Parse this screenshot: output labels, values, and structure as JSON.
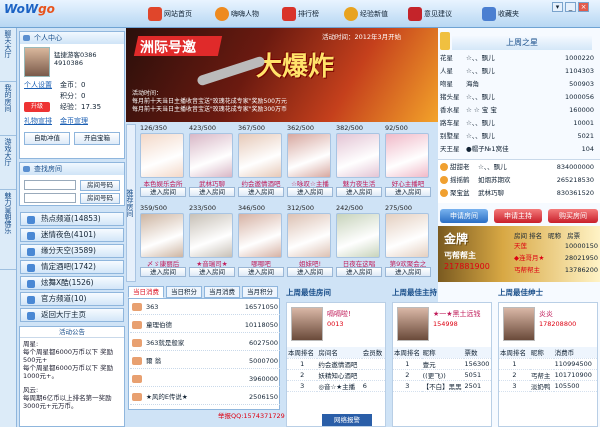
{
  "app": {
    "logo_text": "WoW",
    "logo_accent": "go",
    "window_controls": [
      "▾",
      "_",
      "×"
    ]
  },
  "nav": [
    {
      "label": "网站首页",
      "color": "#e0462b"
    },
    {
      "label": "嗨嗨人物",
      "color": "#ee8a1f"
    },
    {
      "label": "排行榜",
      "color": "#d9332a"
    },
    {
      "label": "经验新值",
      "color": "#e8a320"
    },
    {
      "label": "意见建议",
      "color": "#c4242a"
    },
    {
      "label": "收藏夹",
      "color": "#4b7fd1"
    }
  ],
  "left_strip": [
    "聊天大厅",
    "我的房间",
    "游戏大厅",
    "魅力皇朝佛乐"
  ],
  "profile": {
    "header": "个人中心",
    "nickname": "猛捷游客0386",
    "id": "4910386",
    "setting": "个人设置",
    "stats": [
      {
        "k": "金币",
        "v": "0"
      },
      {
        "k": "积分",
        "v": "0"
      },
      {
        "k": "经验",
        "v": "17.35"
      }
    ],
    "upgrade": "升级",
    "gift": "礼物宣排",
    "recharge": "金币宣理",
    "auto_charge": "自助冲值",
    "open_box": "开启宝箱"
  },
  "search": {
    "header": "查找房间",
    "room_btn": "房间号码",
    "room_btn2": "房间号码"
  },
  "menu": [
    {
      "label": "热点频道",
      "count": "(14853)"
    },
    {
      "label": "迷情夜色",
      "count": "(4101)"
    },
    {
      "label": "缘分天空",
      "count": "(3589)"
    },
    {
      "label": "情定酒吧",
      "count": "(1742)"
    },
    {
      "label": "炫舞X酷",
      "count": "(1526)"
    },
    {
      "label": "官方频道",
      "count": "(10)"
    },
    {
      "label": "返回大厅主页",
      "count": ""
    }
  ],
  "notice": {
    "header": "活动公告",
    "lines": [
      "周星:",
      "每个周星都6000万币以下 奖励500元+",
      "每个周星都6000万币以下 奖励1000元+。",
      "",
      "风云:",
      "每周期6亿币以上排名第一奖励3000元+元万币。"
    ]
  },
  "banner": {
    "title1": "洲际号邀",
    "title2": "大爆炸",
    "time": "活动时间：2012年3月开始",
    "lines": [
      "活动时间：",
      "每月前十天当日主播收音宝送\"玫瑰花成专家\"奖励500万元",
      "每月前十天当日主播收音宝送\"玫瑰花成专家\"奖励300万币"
    ]
  },
  "room_side_label": "推荐房间",
  "rooms": [
    {
      "count": "126/350",
      "name": "本色娱乐会所",
      "tone": "#f3d8c8"
    },
    {
      "count": "423/500",
      "name": "武林巧聊",
      "tone": "#d8b7c6"
    },
    {
      "count": "367/500",
      "name": "约会邀情酒吧",
      "tone": "#e6c9b8"
    },
    {
      "count": "362/500",
      "name": "☆咏叹☆主播",
      "tone": "#d7a8a0"
    },
    {
      "count": "382/500",
      "name": "魅力夜生活",
      "tone": "#e3c4d4"
    },
    {
      "count": "92/500",
      "name": "好心主播吧",
      "tone": "#f0b9c8"
    },
    {
      "count": "359/500",
      "name": "〆ゞ康丽后",
      "tone": "#cdb5a2"
    },
    {
      "count": "233/500",
      "name": "★音瑞司★",
      "tone": "#c7c0b6"
    },
    {
      "count": "346/500",
      "name": "哪哪吧",
      "tone": "#d6b2a4"
    },
    {
      "count": "312/500",
      "name": "姐妹吧!",
      "tone": "#dcc1b3"
    },
    {
      "count": "242/500",
      "name": "日夜在这唱",
      "tone": "#c7d3bb"
    },
    {
      "count": "275/500",
      "name": "第9欢聚会之",
      "tone": "#e4cfc0"
    }
  ],
  "enter_label": "进入房间",
  "week_star": {
    "title": "上周之星",
    "rows": [
      {
        "k": "花星",
        "n": "☆、、飘儿",
        "v": "1000220"
      },
      {
        "k": "人星",
        "n": "☆、、飘儿",
        "v": "1104303"
      },
      {
        "k": "吻星",
        "n": "海角",
        "v": "500903"
      },
      {
        "k": "猪头星",
        "n": "☆、、飘儿",
        "v": "1000056"
      },
      {
        "k": "香水星",
        "n": "☆ ☆ 宝 宝",
        "v": "160000"
      },
      {
        "k": "路车星",
        "n": "☆、、飘儿",
        "v": "10001"
      },
      {
        "k": "别墅星",
        "n": "☆、、飘儿",
        "v": "5021"
      },
      {
        "k": "天王星",
        "n": "●帽子№1窝佳",
        "v": "104"
      }
    ],
    "top": [
      {
        "n": "甜甜老",
        "v": "834000000"
      },
      {
        "n": "摇摇鹤",
        "v": "265218530"
      },
      {
        "n": "聚宝盆",
        "v": "830361520"
      }
    ],
    "top_mid": [
      "☆、、飘儿",
      "如烟苏期欢 ",
      "武林巧聊"
    ]
  },
  "right_btns": [
    "申请房间",
    "申请主持",
    "购买房间"
  ],
  "host_ranks": {
    "header": [
      "房间 排名",
      "昵称",
      "房票"
    ],
    "rows": [
      {
        "n": "天莲",
        "v": "10000150"
      },
      {
        "n": "◆连哥月★",
        "v": "28021950"
      },
      {
        "n": "丐帮帮主",
        "v": "13786200"
      }
    ],
    "badge": "金牌",
    "badge_name": "丐帮帮主",
    "badge_id": "217881900"
  },
  "tabs": [
    "当日消费",
    "当日积分",
    "当月消费",
    "当月积分"
  ],
  "rank_list": [
    {
      "n": "363",
      "v": "16571050"
    },
    {
      "n": "童理伯德",
      "v": "10118050"
    },
    {
      "n": "363就是般家",
      "v": "6027500"
    },
    {
      "n": "爾 翁",
      "v": "5000700"
    },
    {
      "n": "",
      "v": "3960000"
    },
    {
      "n": "★风的E传说★",
      "v": "2506150"
    }
  ],
  "sections": [
    {
      "title": "上周最佳房间",
      "winner": "嗝嗝啦!",
      "id": "0013",
      "table": {
        "head": [
          "本周排名",
          "房间名",
          "会员数"
        ],
        "rows": [
          [
            "1",
            "约会邀情酒吧",
            ""
          ],
          [
            "2",
            "妖精知心酒吧",
            ""
          ],
          [
            "3",
            "◎音☆★主播",
            "6"
          ]
        ]
      }
    },
    {
      "title": "上周最佳主持",
      "winner": "★一★黑土远钱",
      "id": "154998",
      "table": {
        "head": [
          "本周排名",
          "昵称",
          "票数"
        ],
        "rows": [
          [
            "1",
            "壹元",
            "156300"
          ],
          [
            "2",
            "((更飞))",
            "5051"
          ],
          [
            "3",
            "【不白】黑黑",
            "2501"
          ]
        ]
      }
    },
    {
      "title": "上周最佳绅士",
      "winner": "炎炎",
      "id": "178208800",
      "table": {
        "head": [
          "本周排名",
          "昵称",
          "消费币"
        ],
        "rows": [
          [
            "1",
            "",
            "110994500"
          ],
          [
            "2",
            "丐帮主",
            "101710900"
          ],
          [
            "3",
            "淡奶鸭",
            "105500"
          ]
        ]
      }
    }
  ],
  "footer": {
    "qq": "举报QQ:1574371729",
    "report": "网络报警"
  }
}
